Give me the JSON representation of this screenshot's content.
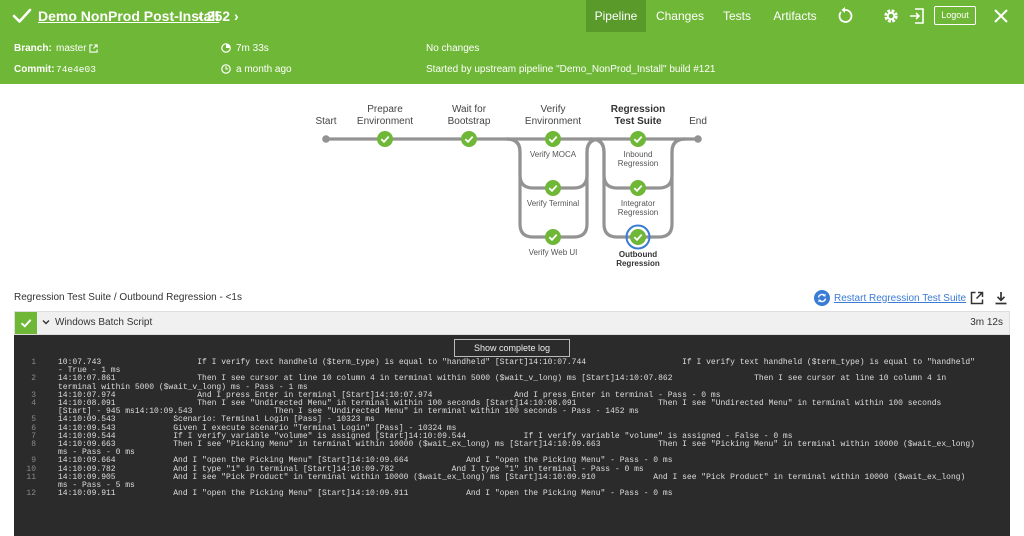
{
  "header": {
    "title": "Demo NonProd Post-Install",
    "run_number": "252",
    "tabs": [
      "Pipeline",
      "Changes",
      "Tests",
      "Artifacts"
    ],
    "active_tab": "Pipeline",
    "logout_label": "Logout",
    "icons": [
      "check-icon",
      "chevron-left-icon",
      "chevron-right-icon",
      "replay-icon",
      "gear-icon",
      "exit-icon",
      "close-icon"
    ]
  },
  "meta": {
    "branch_label": "Branch:",
    "branch_value": "master",
    "commit_label": "Commit:",
    "commit_value": "74e4e03",
    "duration": "7m 33s",
    "time_ago": "a month ago",
    "changes": "No changes",
    "started_by": "Started by upstream pipeline \"Demo_NonProd_Install\" build #121"
  },
  "pipeline": {
    "stages": [
      {
        "label": "Start"
      },
      {
        "label": "Prepare Environment"
      },
      {
        "label": "Wait for Bootstrap"
      },
      {
        "label": "Verify Environment"
      },
      {
        "label": "Regression Test Suite"
      },
      {
        "label": "End"
      }
    ],
    "verify_branches": [
      "Verify MOCA",
      "Verify Terminal",
      "Verify Web UI"
    ],
    "regression_branches": [
      "Inbound Regression",
      "Integrator Regression",
      "Outbound Regression"
    ],
    "selected_branch": "Outbound Regression"
  },
  "step": {
    "breadcrumb": "Regression Test Suite / Outbound Regression - <1s",
    "restart_label": "Restart Regression Test Suite",
    "name": "Windows Batch Script",
    "duration": "3m 12s",
    "show_log_label": "Show complete log"
  },
  "log_lines": [
    {
      "n": "1",
      "text": "10:07.743                    If I verify text handheld ($term_type) is equal to \"handheld\" [Start]14:10:07.744                    If I verify text handheld ($term_type) is equal to \"handheld\" - True - 1 ms"
    },
    {
      "n": "2",
      "text": "14:10:07.861                 Then I see cursor at line 10 column 4 in terminal within 5000 ($wait_v_long) ms [Start]14:10:07.862                 Then I see cursor at line 10 column 4 in terminal within 5000 ($wait_v_long) ms - Pass - 1 ms"
    },
    {
      "n": "3",
      "text": "14:10:07.974                 And I press Enter in terminal [Start]14:10:07.974                 And I press Enter in terminal - Pass - 0 ms"
    },
    {
      "n": "4",
      "text": "14:10:08.091                 Then I see \"Undirected Menu\" in terminal within 100 seconds [Start]14:10:08.091                 Then I see \"Undirected Menu\" in terminal within 100 seconds [Start] - 945 ms14:10:09.543                 Then I see \"Undirected Menu\" in terminal within 100 seconds - Pass - 1452 ms"
    },
    {
      "n": "5",
      "text": "14:10:09.543            Scenario: Terminal Login [Pass] - 10323 ms"
    },
    {
      "n": "6",
      "text": "14:10:09.543            Given I execute scenario \"Terminal Login\" [Pass] - 10324 ms"
    },
    {
      "n": "7",
      "text": "14:10:09.544            If I verify variable \"volume\" is assigned [Start]14:10:09.544            If I verify variable \"volume\" is assigned - False - 0 ms"
    },
    {
      "n": "8",
      "text": "14:10:09.663            Then I see \"Picking Menu\" in terminal within 10000 ($wait_ex_long) ms [Start]14:10:09.663            Then I see \"Picking Menu\" in terminal within 10000 ($wait_ex_long) ms - Pass - 0 ms"
    },
    {
      "n": "9",
      "text": "14:10:09.664            And I \"open the Picking Menu\" [Start]14:10:09.664            And I \"open the Picking Menu\" - Pass - 0 ms"
    },
    {
      "n": "10",
      "text": "14:10:09.782            And I type \"1\" in terminal [Start]14:10:09.782            And I type \"1\" in terminal - Pass - 0 ms"
    },
    {
      "n": "11",
      "text": "14:10:09.905            And I see \"Pick Product\" in terminal within 10000 ($wait_ex_long) ms [Start]14:10:09.910            And I see \"Pick Product\" in terminal within 10000 ($wait_ex_long) ms - Pass - 5 ms"
    },
    {
      "n": "12",
      "text": "14:10:09.911            And I \"open the Picking Menu\" [Start]14:10:09.911            And I \"open the Picking Menu\" - Pass - 0 ms"
    }
  ],
  "colors": {
    "success_green": "#6fb737",
    "active_tab": "#5a9a2b",
    "selected_ring": "#3a7bd5",
    "log_bg": "#2b2b2b"
  }
}
